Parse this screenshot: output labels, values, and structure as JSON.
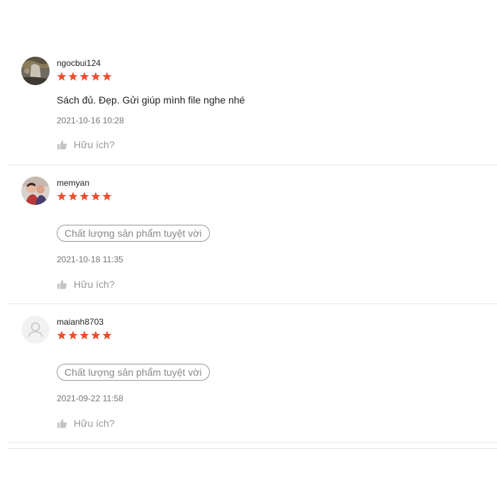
{
  "reviews": [
    {
      "username": "ngocbui124",
      "rating": 5,
      "comment": "Sách đủ. Đẹp. Gửi giúp mình file nghe nhé",
      "date": "2021-10-16 10:28",
      "helpful_label": "Hữu ích?",
      "avatar": "photo-avatar"
    },
    {
      "username": "memyan",
      "rating": 5,
      "tag": "Chất lượng sản phẩm tuyệt vời",
      "date": "2021-10-18 11:35",
      "helpful_label": "Hữu ích?",
      "avatar": "photo-avatar"
    },
    {
      "username": "maianh8703",
      "rating": 5,
      "tag": "Chất lượng sản phẩm tuyệt vời",
      "date": "2021-09-22 11:58",
      "helpful_label": "Hữu ích?",
      "avatar": "default-user-icon"
    }
  ],
  "colors": {
    "star": "#ee4d2d",
    "tag_border": "#999999",
    "muted_text": "#999999"
  }
}
